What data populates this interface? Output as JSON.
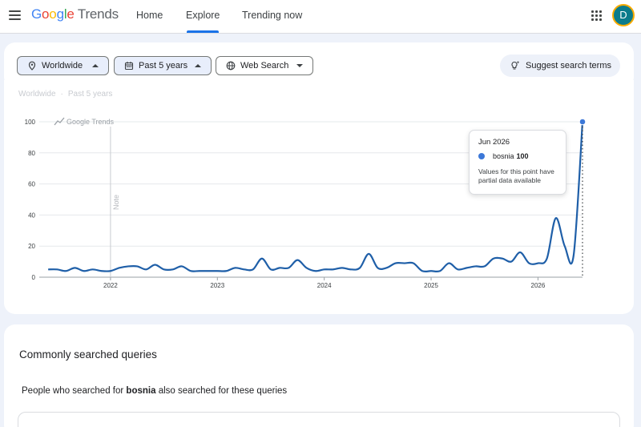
{
  "header": {
    "logo": {
      "google": "Google",
      "trends": "Trends"
    },
    "tabs": [
      {
        "label": "Home"
      },
      {
        "label": "Explore"
      },
      {
        "label": "Trending now"
      }
    ],
    "avatar_initial": "D"
  },
  "filters": {
    "location": "Worldwide",
    "time_range": "Past 5 years",
    "search_type": "Web Search",
    "suggest_label": "Suggest search terms"
  },
  "chart_header": {
    "location": "Worldwide",
    "time_range": "Past 5 years"
  },
  "chart_watermark": "Google Trends",
  "chart_note": "Note",
  "tooltip": {
    "date": "Jun 2026",
    "term": "bosnia",
    "value": "100",
    "note": "Values for this point have partial data available"
  },
  "colors": {
    "series": "#1f5fa8",
    "accent": "#1a73e8",
    "tooltip_dot": "#3c78d8"
  },
  "chart_data": {
    "type": "line",
    "series": [
      {
        "name": "bosnia",
        "points": [
          [
            "2021-06",
            5
          ],
          [
            "2021-07",
            5
          ],
          [
            "2021-08",
            4
          ],
          [
            "2021-09",
            6
          ],
          [
            "2021-10",
            4
          ],
          [
            "2021-11",
            5
          ],
          [
            "2021-12",
            4
          ],
          [
            "2022-01",
            4
          ],
          [
            "2022-02",
            6
          ],
          [
            "2022-03",
            7
          ],
          [
            "2022-04",
            7
          ],
          [
            "2022-05",
            5
          ],
          [
            "2022-06",
            8
          ],
          [
            "2022-07",
            5
          ],
          [
            "2022-08",
            5
          ],
          [
            "2022-09",
            7
          ],
          [
            "2022-10",
            4
          ],
          [
            "2022-11",
            4
          ],
          [
            "2022-12",
            4
          ],
          [
            "2023-01",
            4
          ],
          [
            "2023-02",
            4
          ],
          [
            "2023-03",
            6
          ],
          [
            "2023-04",
            5
          ],
          [
            "2023-05",
            5
          ],
          [
            "2023-06",
            12
          ],
          [
            "2023-07",
            5
          ],
          [
            "2023-08",
            6
          ],
          [
            "2023-09",
            6
          ],
          [
            "2023-10",
            11
          ],
          [
            "2023-11",
            6
          ],
          [
            "2023-12",
            4
          ],
          [
            "2024-01",
            5
          ],
          [
            "2024-02",
            5
          ],
          [
            "2024-03",
            6
          ],
          [
            "2024-04",
            5
          ],
          [
            "2024-05",
            6
          ],
          [
            "2024-06",
            15
          ],
          [
            "2024-07",
            6
          ],
          [
            "2024-08",
            6
          ],
          [
            "2024-09",
            9
          ],
          [
            "2024-10",
            9
          ],
          [
            "2024-11",
            9
          ],
          [
            "2024-12",
            4
          ],
          [
            "2025-01",
            4
          ],
          [
            "2025-02",
            4
          ],
          [
            "2025-03",
            9
          ],
          [
            "2025-04",
            5
          ],
          [
            "2025-05",
            6
          ],
          [
            "2025-06",
            7
          ],
          [
            "2025-07",
            7
          ],
          [
            "2025-08",
            12
          ],
          [
            "2025-09",
            12
          ],
          [
            "2025-10",
            10
          ],
          [
            "2025-11",
            16
          ],
          [
            "2025-12",
            9
          ],
          [
            "2026-01",
            9
          ],
          [
            "2026-02",
            12
          ],
          [
            "2026-03",
            38
          ],
          [
            "2026-04",
            20
          ],
          [
            "2026-05",
            14
          ],
          [
            "2026-06",
            100
          ]
        ]
      }
    ],
    "x_ticks": [
      "2022",
      "2023",
      "2024",
      "2025",
      "2026"
    ],
    "y_ticks": [
      0,
      20,
      40,
      60,
      80,
      100
    ],
    "ylim": [
      0,
      100
    ],
    "xlim": [
      "2021-05",
      "2026-06"
    ],
    "grid": true,
    "partial_from": "2026-06",
    "note_at": "2022-01"
  },
  "queries": {
    "title": "Commonly searched queries",
    "subtitle_prefix": "People who searched for",
    "subtitle_term": "bosnia",
    "subtitle_suffix": "also searched for these queries"
  }
}
